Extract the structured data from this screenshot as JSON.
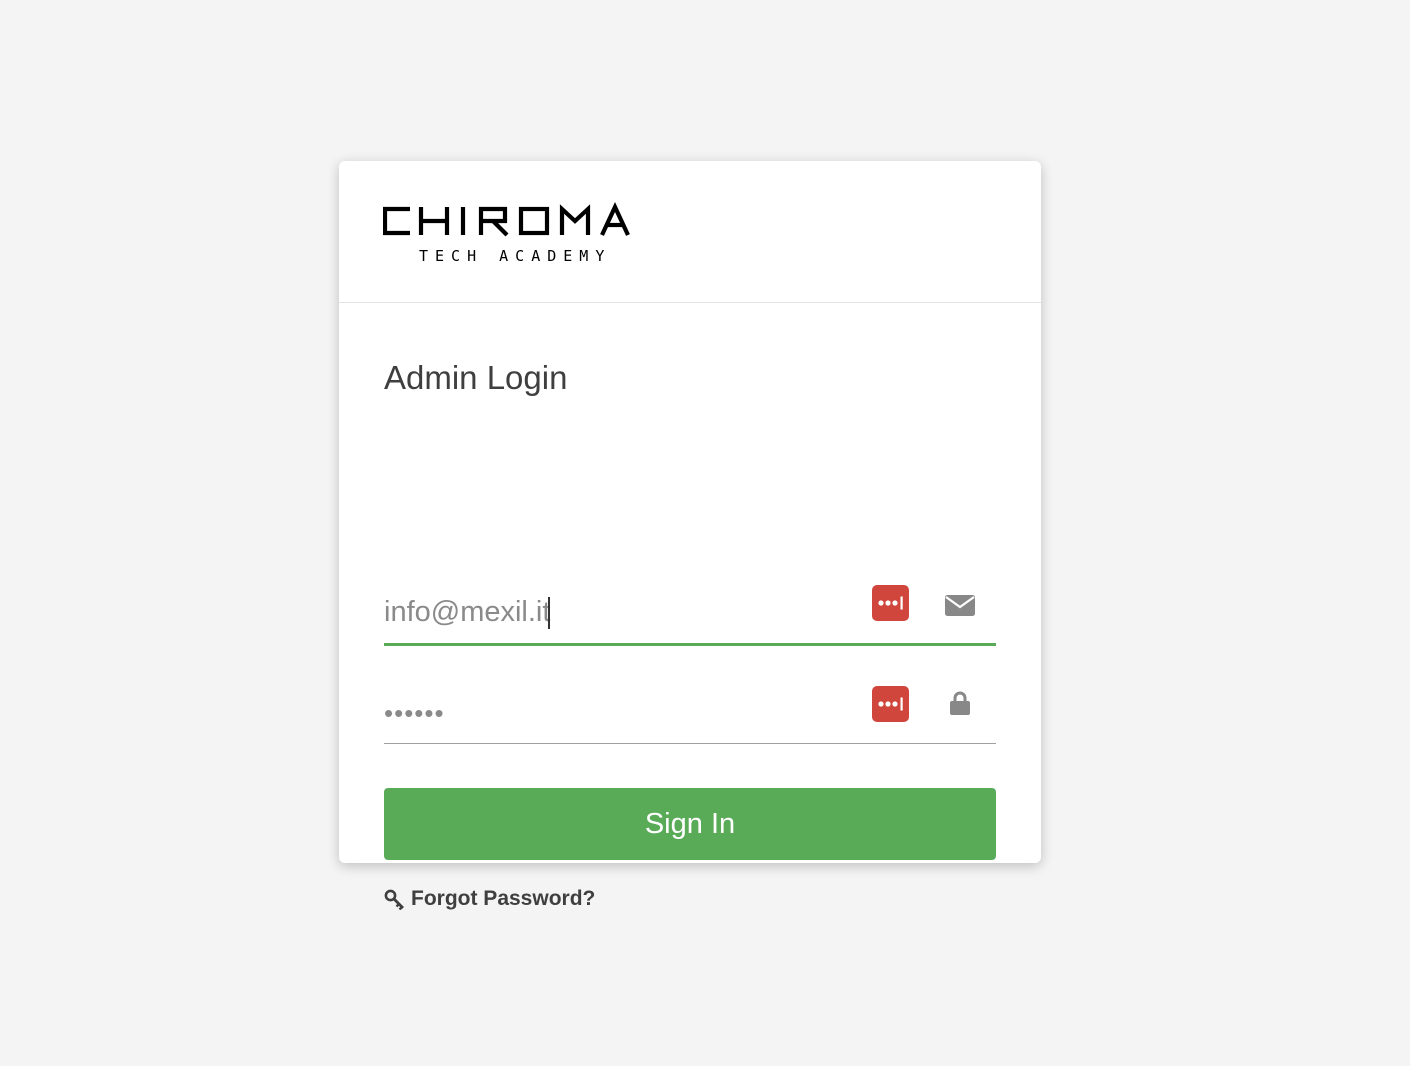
{
  "logo": {
    "primary": "CHROMA",
    "secondary": "TECH ACADEMY"
  },
  "login": {
    "title": "Admin Login",
    "email_value": "info@mexil.it",
    "password_value": "••••••",
    "email_icon": "envelope-icon",
    "password_icon": "lock-icon",
    "password_manager_icon": "password-manager-icon",
    "submit_label": "Sign In",
    "forgot_label": "Forgot Password?",
    "forgot_icon": "key-icon"
  },
  "colors": {
    "accent": "#5aab57",
    "password_manager": "#d0463c",
    "background": "#f4f4f4",
    "text": "#3f3f3f"
  }
}
